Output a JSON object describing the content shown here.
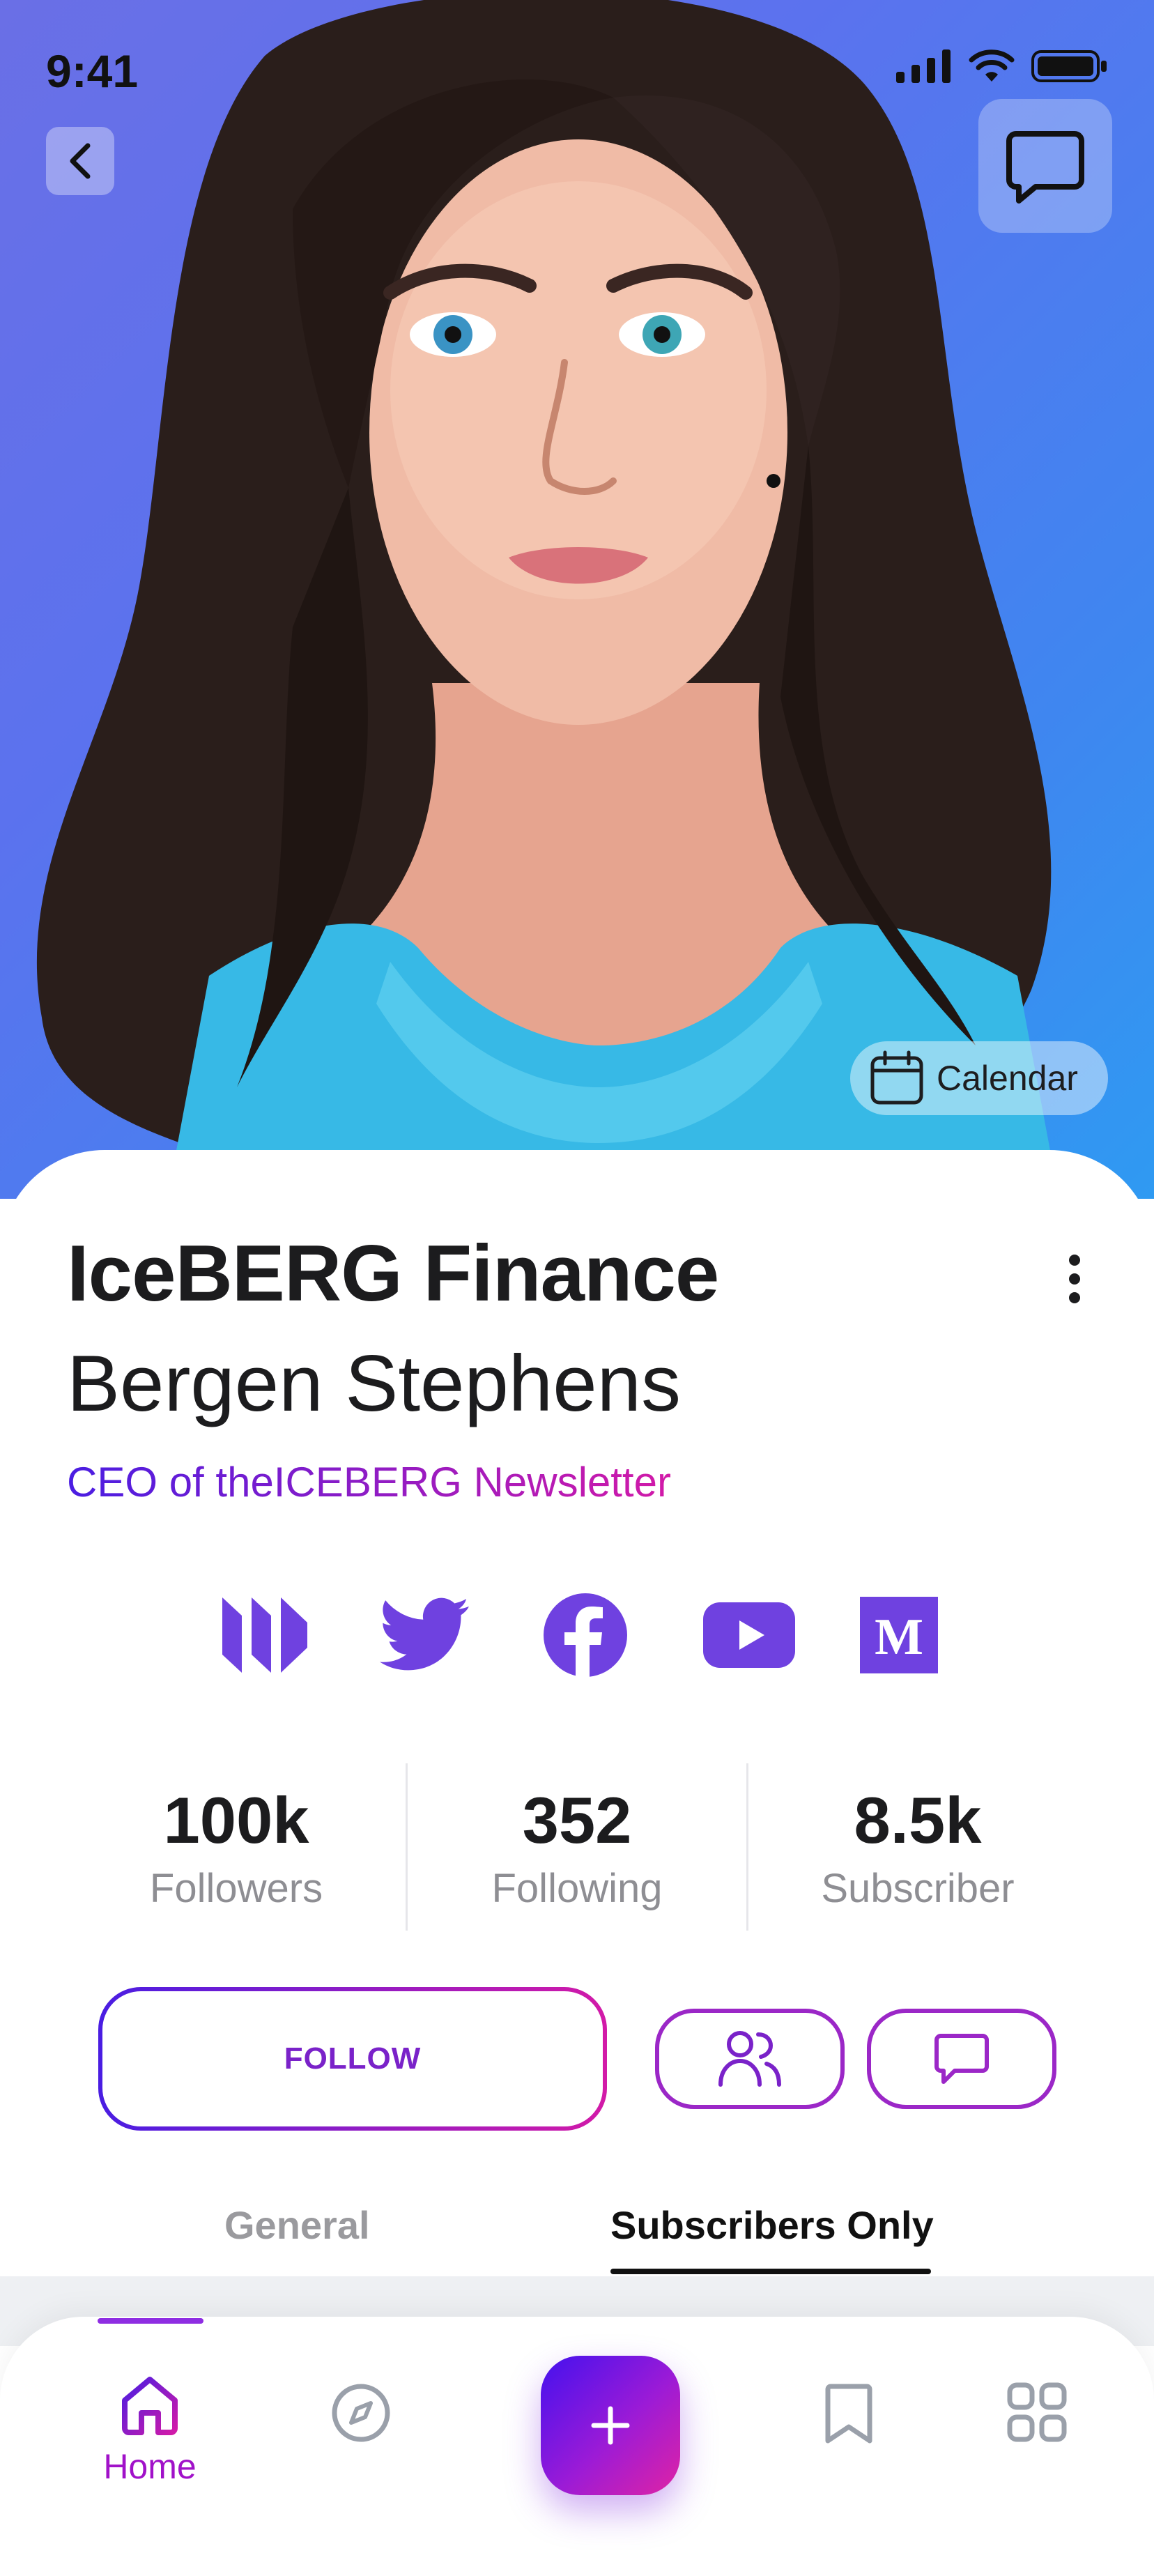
{
  "status_bar": {
    "time": "9:41"
  },
  "hero": {
    "calendar_label": "Calendar",
    "photo_subject": "portrait illustration"
  },
  "profile": {
    "organization": "IceBERG Finance",
    "name": "Bergen Stephens",
    "role": "CEO of theICEBERG Newsletter"
  },
  "social_links": [
    {
      "icon": "substack-icon"
    },
    {
      "icon": "twitter-icon"
    },
    {
      "icon": "facebook-icon"
    },
    {
      "icon": "youtube-icon"
    },
    {
      "icon": "medium-icon"
    }
  ],
  "stats": [
    {
      "value": "100k",
      "label": "Followers"
    },
    {
      "value": "352",
      "label": "Following"
    },
    {
      "value": "8.5k",
      "label": "Subscriber"
    }
  ],
  "actions": {
    "follow_label": "FOLLOW",
    "friends_icon": "users-icon",
    "message_icon": "chat-icon"
  },
  "tabs": [
    {
      "label": "General",
      "active": false
    },
    {
      "label": "Subscribers Only",
      "active": true
    }
  ],
  "bottom_nav": {
    "home_label": "Home",
    "items": [
      "home-icon",
      "compass-icon",
      "plus-icon",
      "bookmark-icon",
      "grid-icon"
    ]
  },
  "colors": {
    "accent_start": "#4411ee",
    "accent_end": "#e023a4",
    "social_purple": "#6f41e0",
    "hero_blue": "#3f86f0"
  }
}
